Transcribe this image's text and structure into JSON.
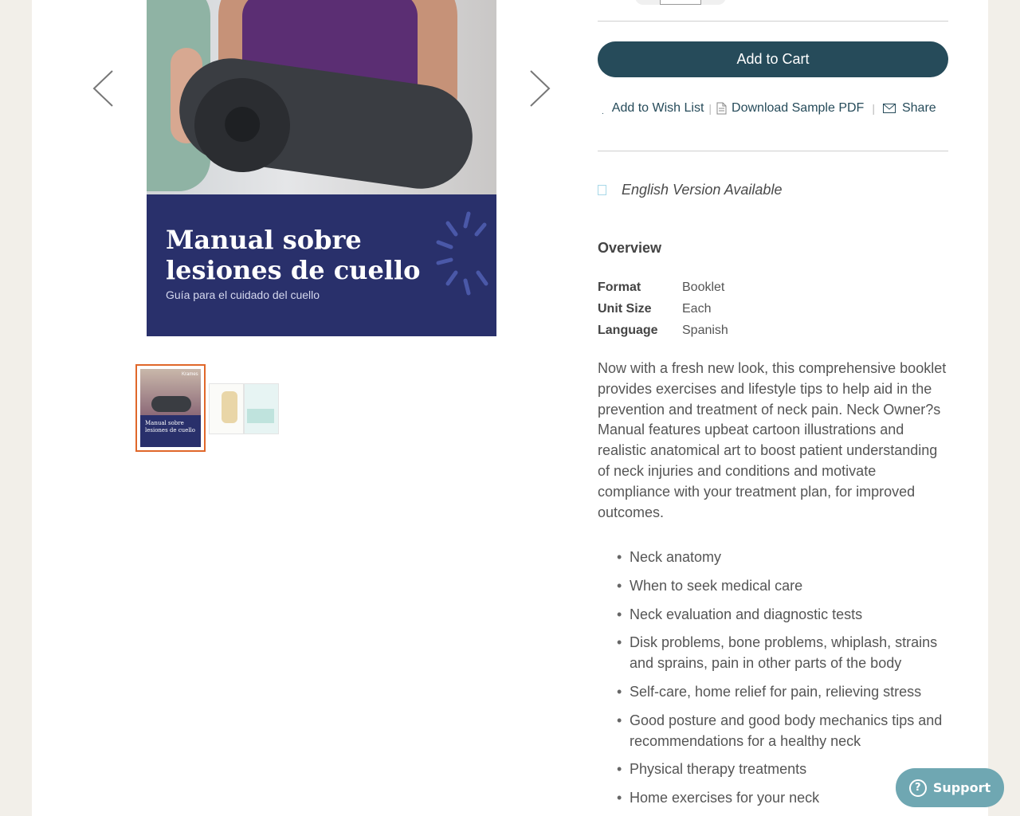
{
  "gallery": {
    "cover_title": "Manual sobre\nlesiones de cuello",
    "cover_subtitle": "Guía para el cuidado del cuello",
    "thumb_title": "Manual sobre\nlesiones de cuello",
    "thumb_brand": "Krames",
    "prev_icon": "chevron-left-icon",
    "next_icon": "chevron-right-icon"
  },
  "product": {
    "quantity": "",
    "add_to_cart": "Add to Cart",
    "actions": {
      "wishlist": "Add to Wish List",
      "separator": "|",
      "download": "Download Sample PDF",
      "share": "Share"
    },
    "english_version": "English Version Available",
    "overview_heading": "Overview",
    "specs": [
      {
        "label": "Format",
        "value": "Booklet"
      },
      {
        "label": "Unit Size",
        "value": "Each"
      },
      {
        "label": "Language",
        "value": "Spanish"
      }
    ],
    "description": "Now with a fresh new look, this comprehensive booklet provides exercises and lifestyle tips to help aid in the prevention and treatment of neck pain. Neck Owner?s Manual features upbeat cartoon illustrations and realistic anatomical art to boost patient understanding of neck injuries and conditions and motivate compliance with your treatment plan, for improved outcomes.",
    "bullets": [
      "Neck anatomy",
      "When to seek medical care",
      "Neck evaluation and diagnostic tests",
      "Disk problems, bone problems, whiplash, strains and sprains, pain in other parts of the body",
      "Self-care, home relief for pain, relieving stress",
      "Good posture and good body mechanics tips and recommendations for a healthy neck",
      "Physical therapy treatments",
      "Home exercises for your neck"
    ]
  },
  "support": {
    "label": "Support"
  },
  "colors": {
    "accent": "#264b5a",
    "cover_band": "#29306b",
    "thumb_selected": "#e0672a",
    "support": "#6fa7b2"
  }
}
